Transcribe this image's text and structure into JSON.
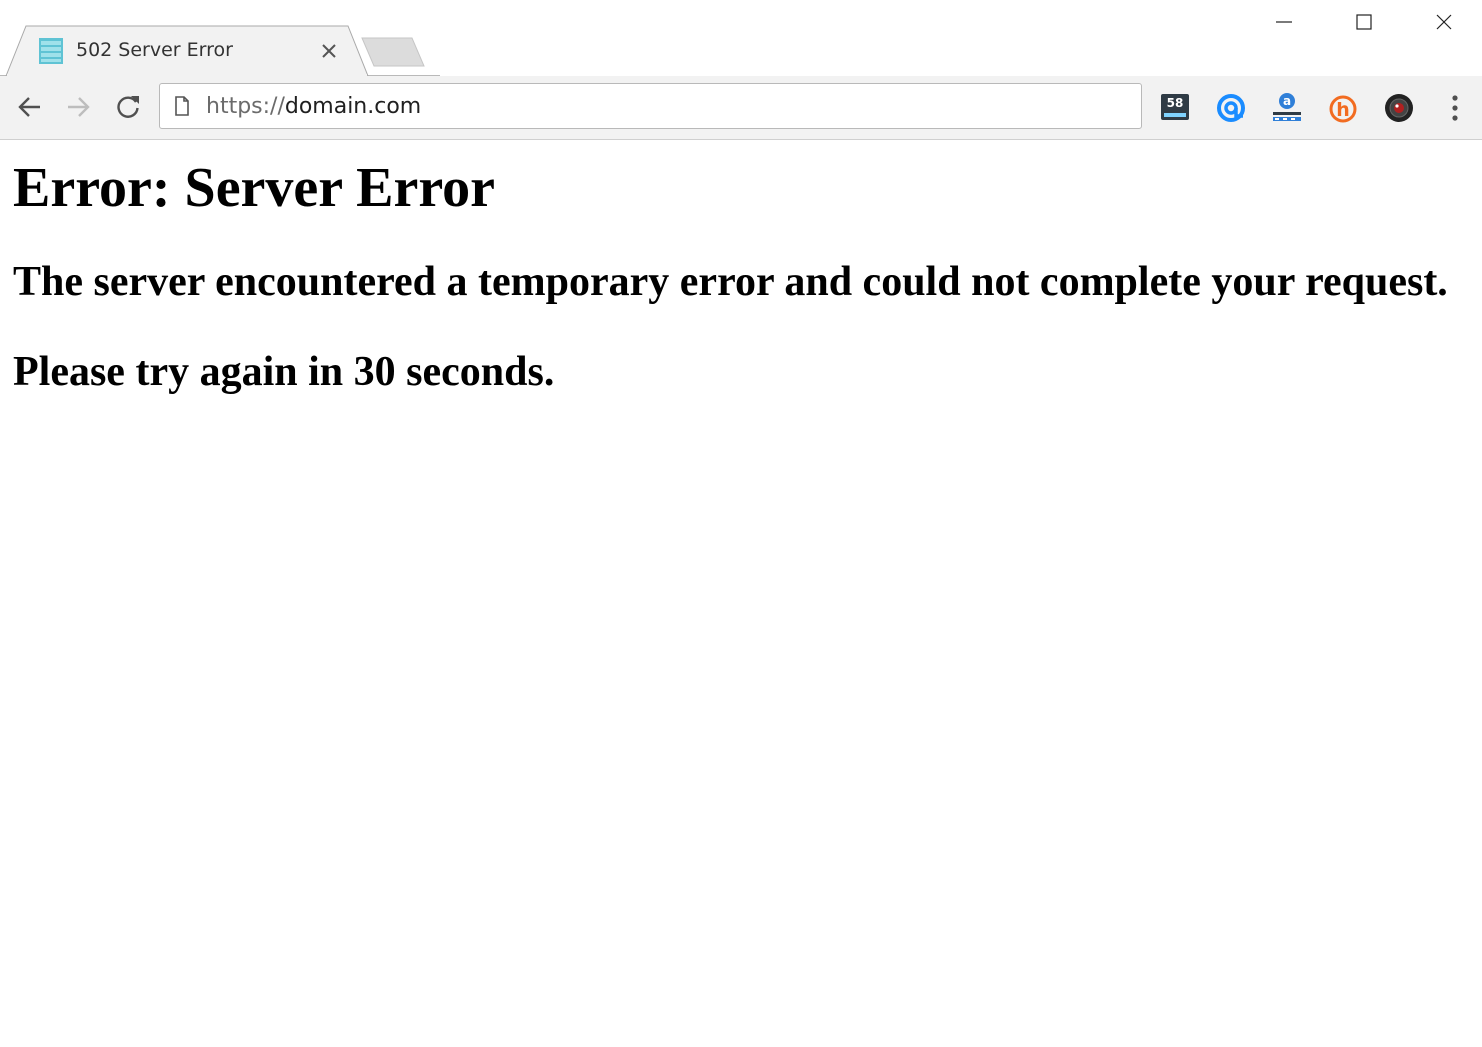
{
  "tab": {
    "title": "502 Server Error",
    "favicon": "server-icon"
  },
  "address_bar": {
    "scheme": "https://",
    "host": "domain.com"
  },
  "extensions": [
    {
      "name": "speedtest-extension",
      "label": "58"
    },
    {
      "name": "at-sign-extension"
    },
    {
      "name": "amazon-assistant-extension",
      "label": "a"
    },
    {
      "name": "honey-extension",
      "label": "h"
    },
    {
      "name": "camera-extension"
    }
  ],
  "page": {
    "heading": "Error: Server Error",
    "message": "The server encountered a temporary error and could not complete your request.",
    "retry": "Please try again in 30 seconds."
  },
  "colors": {
    "toolbar_bg": "#f2f2f2",
    "at_icon": "#1a8cff",
    "honey_icon": "#f26c21",
    "favicon": "#5fc3d4"
  }
}
